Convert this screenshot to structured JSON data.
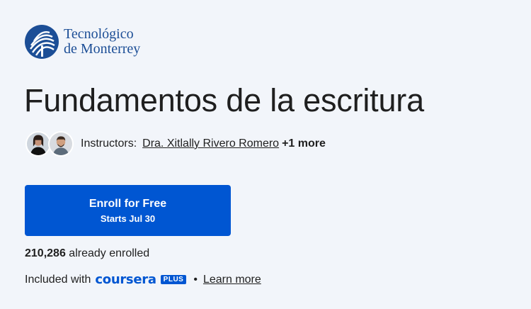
{
  "brand": {
    "partner_logo": {
      "line1": "Tecnológico",
      "line2": "de Monterrey",
      "icon": "tec-monterrey-logo-icon",
      "color": "#1c4e96"
    }
  },
  "course": {
    "title": "Fundamentos de la escritura"
  },
  "instructors": {
    "label": "Instructors:",
    "primary_name": "Dra. Xitlally Rivero Romero",
    "more": "+1 more",
    "avatars": [
      "avatar-woman-icon",
      "avatar-man-icon"
    ]
  },
  "enroll_button": {
    "label": "Enroll for Free",
    "sublabel": "Starts Jul 30",
    "color": "#0056d2"
  },
  "enrollment": {
    "count": "210,286",
    "suffix": "already enrolled"
  },
  "included": {
    "prefix": "Included with",
    "brand_word": "coursera",
    "badge": "PLUS",
    "separator": "•",
    "learn_more": "Learn more"
  }
}
